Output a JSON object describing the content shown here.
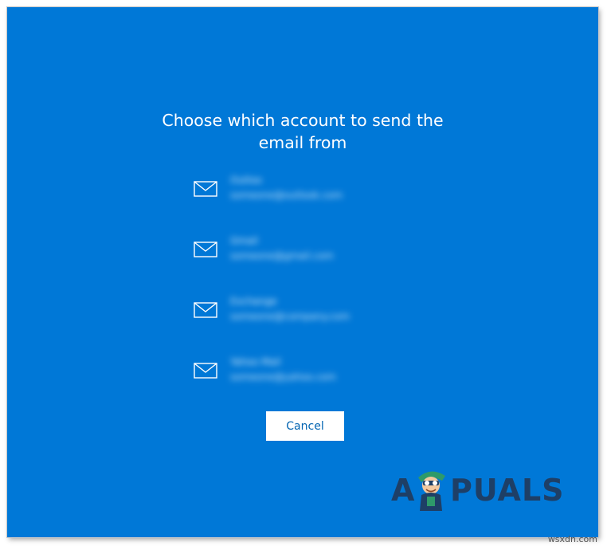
{
  "dialog": {
    "title_line1": "Choose which account to send the",
    "title_line2": "email from",
    "accounts": [
      {
        "name": "Outlook",
        "address": "someone@outlook.com"
      },
      {
        "name": "Gmail",
        "address": "someone@gmail.com"
      },
      {
        "name": "Exchange",
        "address": "someone@company.com"
      },
      {
        "name": "Yahoo Mail",
        "address": "someone@yahoo.com"
      }
    ],
    "cancel_label": "Cancel"
  },
  "branding": {
    "logo_left": "A",
    "logo_right": "PUALS",
    "watermark": "wsxdn.com"
  },
  "colors": {
    "background": "#0078d7",
    "button_bg": "#ffffff",
    "button_text": "#0063b1",
    "logo_text": "#1e3f66"
  },
  "icons": {
    "account": "mail-icon",
    "logo_mascot": "mascot-icon"
  }
}
